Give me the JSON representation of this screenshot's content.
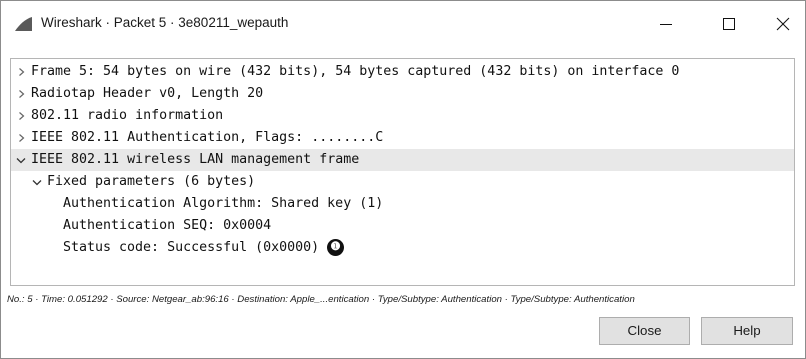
{
  "window": {
    "title": "Wireshark · Packet 5 · 3e80211_wepauth",
    "icon": "wireshark-fin-icon",
    "controls": {
      "minimize": "minimize-icon",
      "maximize": "maximize-icon",
      "close": "close-icon"
    }
  },
  "tree": {
    "rows": [
      {
        "text": "Frame 5: 54 bytes on wire (432 bits), 54 bytes captured (432 bits) on interface 0",
        "expander": "collapsed"
      },
      {
        "text": "Radiotap Header v0, Length 20",
        "expander": "collapsed"
      },
      {
        "text": "802.11 radio information",
        "expander": "collapsed"
      },
      {
        "text": "IEEE 802.11 Authentication, Flags: ........C",
        "expander": "collapsed"
      },
      {
        "text": "IEEE 802.11 wireless LAN management frame",
        "expander": "expanded",
        "selected": true
      },
      {
        "text": "Fixed parameters (6 bytes)",
        "expander": "expanded"
      },
      {
        "text": "Authentication Algorithm: Shared key (1)",
        "expander": "none"
      },
      {
        "text": "Authentication SEQ: 0x0004",
        "expander": "none"
      },
      {
        "text": "Status code: Successful (0x0000)",
        "expander": "none"
      }
    ],
    "callout": "❶"
  },
  "status": {
    "text": "No.: 5 · Time: 0.051292 · Source: Netgear_ab:96:16 · Destination: Apple_...entication · Type/Subtype: Authentication · Type/Subtype: Authentication"
  },
  "buttons": {
    "close": "Close",
    "help": "Help"
  }
}
